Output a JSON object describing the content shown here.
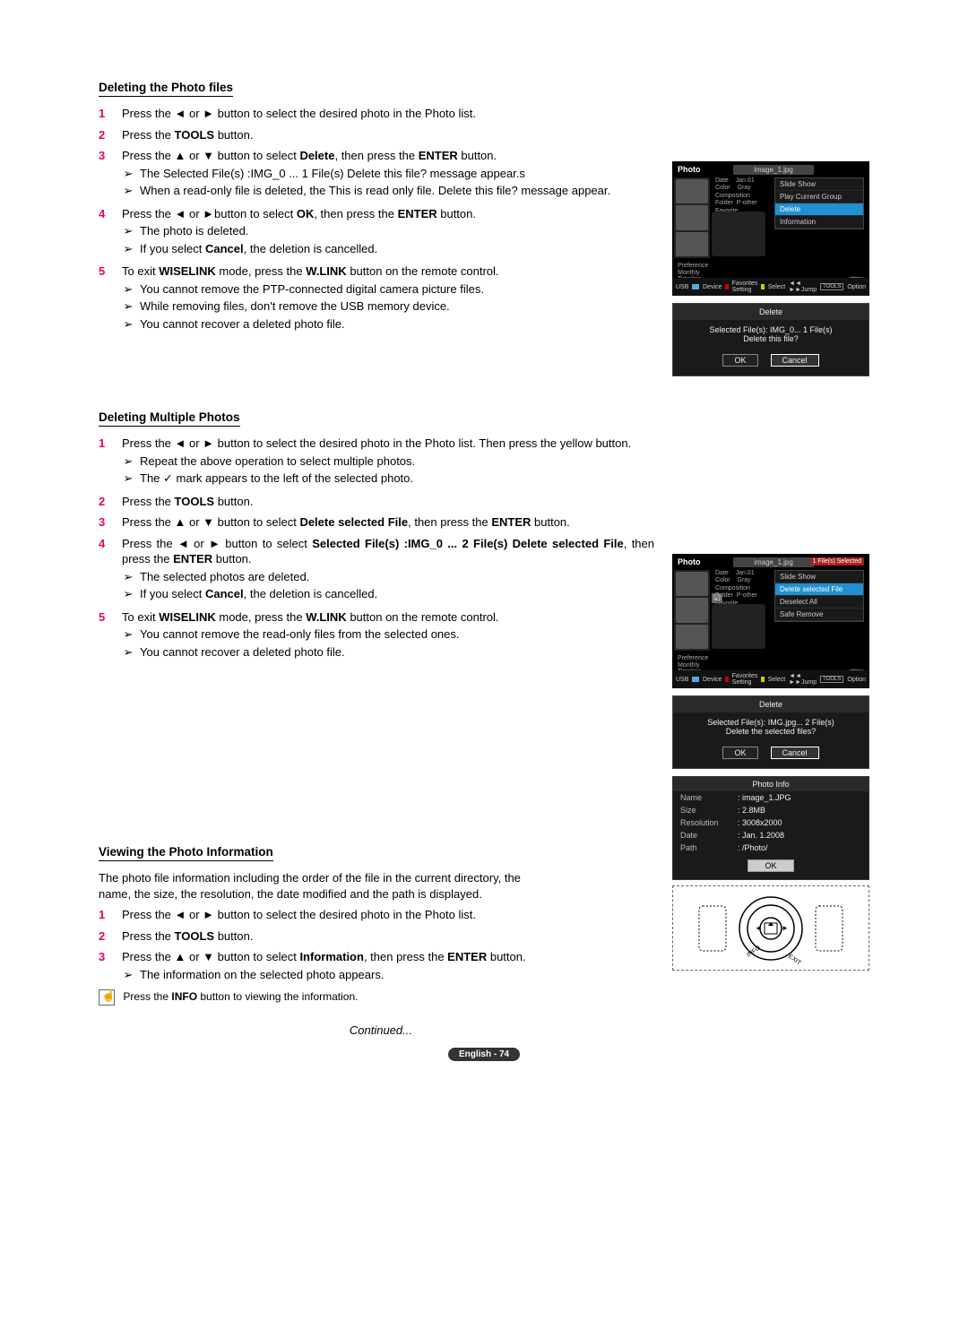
{
  "section1": {
    "title": "Deleting the Photo files",
    "steps": [
      {
        "num": "1",
        "parts": [
          "Press the ◄ or ► button to select the desired photo in the Photo list."
        ]
      },
      {
        "num": "2",
        "parts": [
          "Press the ",
          "TOOLS",
          " button."
        ]
      },
      {
        "num": "3",
        "parts": [
          "Press the ▲ or ▼ button to select ",
          "Delete",
          ", then press the ",
          "ENTER",
          " button."
        ],
        "subs": [
          "The Selected File(s) :IMG_0 ... 1 File(s) Delete this file? message appear.s",
          "When a read-only file is deleted, the This is read only file. Delete this file? message appear."
        ]
      },
      {
        "num": "4",
        "parts": [
          "Press the ◄ or ►button to select ",
          "OK",
          ", then press the ",
          "ENTER",
          " button."
        ],
        "subs": [
          "The photo is deleted.",
          "If you select Cancel, the deletion is cancelled."
        ],
        "subbold": [
          null,
          "Cancel"
        ]
      },
      {
        "num": "5",
        "parts": [
          "To exit ",
          "WISELINK",
          " mode, press the ",
          "W.LINK",
          " button on the remote control."
        ],
        "subs": [
          "You cannot remove the PTP-connected digital camera picture files.",
          "While removing files, don't remove the USB memory device.",
          "You cannot recover a deleted photo file."
        ]
      }
    ]
  },
  "section2": {
    "title": "Deleting Multiple Photos",
    "steps": [
      {
        "num": "1",
        "parts": [
          "Press the ◄ or ► button to select the desired photo in the Photo list. Then press the yellow button."
        ],
        "subs": [
          "Repeat the above operation to select multiple photos.",
          "The ✓ mark appears to the left of the selected photo."
        ]
      },
      {
        "num": "2",
        "parts": [
          "Press the ",
          "TOOLS",
          " button."
        ]
      },
      {
        "num": "3",
        "parts": [
          "Press the ▲ or ▼ button to select ",
          "Delete selected File",
          ", then press the ",
          "ENTER",
          " button."
        ]
      },
      {
        "num": "4",
        "parts": [
          "Press the ◄ or ► button to select ",
          "Selected File(s) :IMG_0 ... 2 File(s) Delete selected File",
          ", then press the ",
          "ENTER",
          " button."
        ],
        "subs": [
          "The selected photos are deleted.",
          "If you select Cancel, the deletion is cancelled."
        ],
        "subbold": [
          null,
          "Cancel"
        ]
      },
      {
        "num": "5",
        "parts": [
          "To exit ",
          "WISELINK",
          " mode, press the ",
          "W.LINK",
          " button on the remote control."
        ],
        "subs": [
          "You cannot remove the read-only files from the selected ones.",
          "You cannot recover a deleted photo file."
        ]
      }
    ]
  },
  "section3": {
    "title": "Viewing the Photo Information",
    "intro": "The photo file information including the order of the file in the current directory, the name, the size, the resolution, the date modified and the path is displayed.",
    "steps": [
      {
        "num": "1",
        "parts": [
          "Press the ◄ or ► button to select the desired photo in the Photo list."
        ]
      },
      {
        "num": "2",
        "parts": [
          "Press the ",
          "TOOLS",
          " button."
        ]
      },
      {
        "num": "3",
        "parts": [
          "Press the ▲ or ▼ button to select  ",
          "Information",
          ", then press the ",
          "ENTER",
          " button."
        ],
        "subs": [
          "The information on the selected photo appears."
        ]
      }
    ],
    "note": [
      "Press the ",
      "INFO",
      " button to viewing the information."
    ]
  },
  "tv1": {
    "header": "Photo",
    "file": "image_1.jpg",
    "meta": [
      "Date",
      "Color",
      "Composition",
      "Folder",
      "Favorite"
    ],
    "metaR": [
      "Jan.01",
      "Gray",
      "",
      "P-other",
      ""
    ],
    "menu": [
      "Slide Show",
      "Play Current Group",
      "Delete",
      "Information"
    ],
    "sel": 2,
    "mid": [
      "Preference",
      "Monthly",
      "Timeline"
    ],
    "nov": "Nov",
    "bottom": {
      "usb": "USB",
      "dev": "Device",
      "fav": "Favorites Setting",
      "sel": "Select",
      "jump": "◄◄ ►►Jump",
      "opt": "TOOLS",
      "optt": "Option"
    }
  },
  "dialog1": {
    "title": "Delete",
    "line1": "Selected File(s): IMG_0...    1 File(s)",
    "line2": "Delete this file?",
    "ok": "OK",
    "cancel": "Cancel"
  },
  "tv2": {
    "header": "Photo",
    "file": "image_1.jpg",
    "badge": "1 File(s) Selected",
    "meta": [
      "Date",
      "Color",
      "Composition",
      "Folder",
      "Favorite"
    ],
    "metaR": [
      "Jan.01",
      "Gray",
      "",
      "P-other",
      ""
    ],
    "menu": [
      "Slide Show",
      "Delete selected File",
      "Deselect All",
      "Safe Remove"
    ],
    "sel": 1,
    "mid": [
      "Preference",
      "Monthly",
      "Timeline"
    ],
    "nov": "Nov",
    "bottom": {
      "usb": "USB",
      "dev": "Device",
      "fav": "Favorites Setting",
      "sel": "Select",
      "jump": "◄◄ ►►Jump",
      "opt": "TOOLS",
      "optt": "Option"
    }
  },
  "dialog2": {
    "title": "Delete",
    "line1": "Selected File(s): IMG.jpg...    2 File(s)",
    "line2": "Delete the selected files?",
    "ok": "OK",
    "cancel": "Cancel"
  },
  "info": {
    "title": "Photo Info",
    "rows": [
      [
        "Name",
        ": image_1.JPG"
      ],
      [
        "Size",
        ": 2.8MB"
      ],
      [
        "Resolution",
        ": 3008x2000"
      ],
      [
        "Date",
        ": Jan. 1.2008"
      ],
      [
        "Path",
        ": /Photo/"
      ]
    ],
    "ok": "OK"
  },
  "continued": "Continued...",
  "footer": "English - 74"
}
